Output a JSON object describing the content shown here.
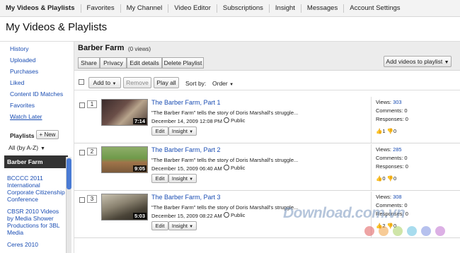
{
  "topnav": {
    "items": [
      "My Videos & Playlists",
      "Favorites",
      "My Channel",
      "Video Editor",
      "Subscriptions",
      "Insight",
      "Messages",
      "Account Settings"
    ]
  },
  "page_title": "My Videos & Playlists",
  "sidebar": {
    "links": [
      "History",
      "Uploaded",
      "Purchases",
      "Liked",
      "Content ID Matches",
      "Favorites",
      "Watch Later"
    ],
    "playlists_label": "Playlists",
    "new_button": "+ New",
    "sort_value": "All (by A-Z)",
    "sort_icon": "caret-down-icon",
    "playlists": [
      "Barber Farm",
      "BCCCC 2011 International Corporate Citizenship Conference",
      "CBSR 2010 Videos by Media Shower Productions for 3BL Media",
      "Ceres 2010"
    ]
  },
  "playlist": {
    "title": "Barber Farm",
    "views": "(0 views)",
    "actions": [
      "Share",
      "Privacy",
      "Edit details",
      "Delete Playlist"
    ],
    "add_videos": "Add videos to playlist",
    "add_videos_icon": "caret-down-icon"
  },
  "toolbar": {
    "add_to": "Add to",
    "remove": "Remove",
    "play_all": "Play all",
    "sort_by_label": "Sort by:",
    "sort_by_value": "Order"
  },
  "videos": [
    {
      "position": "1",
      "duration": "7:14",
      "title": "The Barber Farm, Part 1",
      "description": "\"The Barber Farm\" tells the story of Doris Marshall's struggle...",
      "date": "December 14, 2009 12:08 PM",
      "privacy": "Public",
      "edit": "Edit",
      "insight": "Insight",
      "views_label": "Views:",
      "views": "303",
      "comments": "Comments: 0",
      "responses": "Responses: 0",
      "likes": "1",
      "dislikes": "0"
    },
    {
      "position": "2",
      "duration": "9:05",
      "title": "The Barber Farm, Part 2",
      "description": "\"The Barber Farm\" tells the story of Doris Marshall's struggle...",
      "date": "December 15, 2009 06:40 AM",
      "privacy": "Public",
      "edit": "Edit",
      "insight": "Insight",
      "views_label": "Views:",
      "views": "285",
      "comments": "Comments: 0",
      "responses": "Responses: 0",
      "likes": "0",
      "dislikes": "0"
    },
    {
      "position": "3",
      "duration": "5:03",
      "title": "The Barber Farm, Part 3",
      "description": "\"The Barber Farm\" tells the story of Doris Marshall's struggle...",
      "date": "December 15, 2009 08:22 AM",
      "privacy": "Public",
      "edit": "Edit",
      "insight": "Insight",
      "views_label": "Views:",
      "views": "308",
      "comments": "Comments: 0",
      "responses": "Responses: 0",
      "likes": "2",
      "dislikes": "0"
    }
  ],
  "watermark": "Download.com.vn",
  "colors": {
    "link": "#1a4db3",
    "selected_playlist": "#333333",
    "scroll_thumb": "#4a7bd4",
    "dots": [
      "#e05a5a",
      "#f0a040",
      "#a8d060",
      "#60c0e0",
      "#7a8ee0",
      "#c070d0"
    ]
  }
}
